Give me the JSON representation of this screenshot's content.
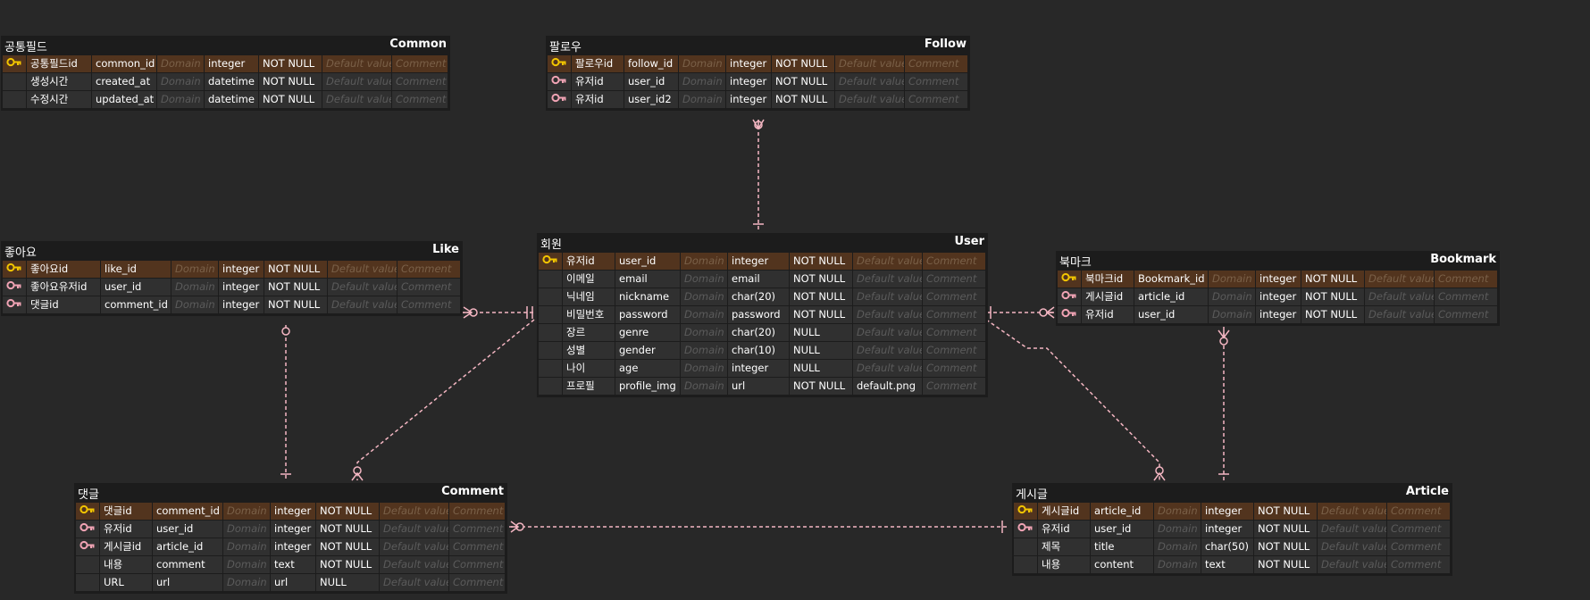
{
  "entities": {
    "common": {
      "logical": "공통필드",
      "physical": "Common",
      "rows": [
        {
          "key": "pk",
          "logical": "공통필드id",
          "physical": "common_id",
          "domain": "Domain",
          "type": "integer",
          "nullable": "NOT NULL",
          "default": "Default value",
          "comment": "Comment"
        },
        {
          "key": "",
          "logical": "생성시간",
          "physical": "created_at",
          "domain": "Domain",
          "type": "datetime",
          "nullable": "NOT NULL",
          "default": "Default value",
          "comment": "Comment"
        },
        {
          "key": "",
          "logical": "수정시간",
          "physical": "updated_at",
          "domain": "Domain",
          "type": "datetime",
          "nullable": "NOT NULL",
          "default": "Default value",
          "comment": "Comment"
        }
      ]
    },
    "follow": {
      "logical": "팔로우",
      "physical": "Follow",
      "rows": [
        {
          "key": "pk",
          "logical": "팔로우id",
          "physical": "follow_id",
          "domain": "Domain",
          "type": "integer",
          "nullable": "NOT NULL",
          "default": "Default value",
          "comment": "Comment"
        },
        {
          "key": "fk",
          "logical": "유저id",
          "physical": "user_id",
          "domain": "Domain",
          "type": "integer",
          "nullable": "NOT NULL",
          "default": "Default value",
          "comment": "Comment"
        },
        {
          "key": "fk",
          "logical": "유저id",
          "physical": "user_id2",
          "domain": "Domain",
          "type": "integer",
          "nullable": "NOT NULL",
          "default": "Default value",
          "comment": "Comment"
        }
      ]
    },
    "like": {
      "logical": "좋아요",
      "physical": "Like",
      "rows": [
        {
          "key": "pk",
          "logical": "좋아요id",
          "physical": "like_id",
          "domain": "Domain",
          "type": "integer",
          "nullable": "NOT NULL",
          "default": "Default value",
          "comment": "Comment"
        },
        {
          "key": "fk",
          "logical": "좋아요유저id",
          "physical": "user_id",
          "domain": "Domain",
          "type": "integer",
          "nullable": "NOT NULL",
          "default": "Default value",
          "comment": "Comment"
        },
        {
          "key": "fk",
          "logical": "댓글id",
          "physical": "comment_id",
          "domain": "Domain",
          "type": "integer",
          "nullable": "NOT NULL",
          "default": "Default value",
          "comment": "Comment"
        }
      ]
    },
    "user": {
      "logical": "회원",
      "physical": "User",
      "rows": [
        {
          "key": "pk",
          "logical": "유저id",
          "physical": "user_id",
          "domain": "Domain",
          "type": "integer",
          "nullable": "NOT NULL",
          "default": "Default value",
          "comment": "Comment"
        },
        {
          "key": "",
          "logical": "이메일",
          "physical": "email",
          "domain": "Domain",
          "type": "email",
          "nullable": "NOT NULL",
          "default": "Default value",
          "comment": "Comment"
        },
        {
          "key": "",
          "logical": "닉네임",
          "physical": "nickname",
          "domain": "Domain",
          "type": "char(20)",
          "nullable": "NOT NULL",
          "default": "Default value",
          "comment": "Comment"
        },
        {
          "key": "",
          "logical": "비밀번호",
          "physical": "password",
          "domain": "Domain",
          "type": "password",
          "nullable": "NOT NULL",
          "default": "Default value",
          "comment": "Comment"
        },
        {
          "key": "",
          "logical": "장르",
          "physical": "genre",
          "domain": "Domain",
          "type": "char(20)",
          "nullable": "NULL",
          "default": "Default value",
          "comment": "Comment"
        },
        {
          "key": "",
          "logical": "성별",
          "physical": "gender",
          "domain": "Domain",
          "type": "char(10)",
          "nullable": "NULL",
          "default": "Default value",
          "comment": "Comment"
        },
        {
          "key": "",
          "logical": "나이",
          "physical": "age",
          "domain": "Domain",
          "type": "integer",
          "nullable": "NULL",
          "default": "Default value",
          "comment": "Comment"
        },
        {
          "key": "",
          "logical": "프로필",
          "physical": "profile_img",
          "domain": "Domain",
          "type": "url",
          "nullable": "NOT NULL",
          "default": "default.png",
          "comment": "Comment"
        }
      ]
    },
    "bookmark": {
      "logical": "북마크",
      "physical": "Bookmark",
      "rows": [
        {
          "key": "pk",
          "logical": "북마크id",
          "physical": "Bookmark_id",
          "domain": "Domain",
          "type": "integer",
          "nullable": "NOT NULL",
          "default": "Default value",
          "comment": "Comment"
        },
        {
          "key": "fk",
          "logical": "게시글id",
          "physical": "article_id",
          "domain": "Domain",
          "type": "integer",
          "nullable": "NOT NULL",
          "default": "Default value",
          "comment": "Comment"
        },
        {
          "key": "fk",
          "logical": "유저id",
          "physical": "user_id",
          "domain": "Domain",
          "type": "integer",
          "nullable": "NOT NULL",
          "default": "Default value",
          "comment": "Comment"
        }
      ]
    },
    "comment": {
      "logical": "댓글",
      "physical": "Comment",
      "rows": [
        {
          "key": "pk",
          "logical": "댓글id",
          "physical": "comment_id",
          "domain": "Domain",
          "type": "integer",
          "nullable": "NOT NULL",
          "default": "Default value",
          "comment": "Comment"
        },
        {
          "key": "fk",
          "logical": "유저id",
          "physical": "user_id",
          "domain": "Domain",
          "type": "integer",
          "nullable": "NOT NULL",
          "default": "Default value",
          "comment": "Comment"
        },
        {
          "key": "fk",
          "logical": "게시글id",
          "physical": "article_id",
          "domain": "Domain",
          "type": "integer",
          "nullable": "NOT NULL",
          "default": "Default value",
          "comment": "Comment"
        },
        {
          "key": "",
          "logical": "내용",
          "physical": "comment",
          "domain": "Domain",
          "type": "text",
          "nullable": "NOT NULL",
          "default": "Default value",
          "comment": "Comment"
        },
        {
          "key": "",
          "logical": "URL",
          "physical": "url",
          "domain": "Domain",
          "type": "url",
          "nullable": "NULL",
          "default": "Default value",
          "comment": "Comment"
        }
      ]
    },
    "article": {
      "logical": "게시글",
      "physical": "Article",
      "rows": [
        {
          "key": "pk",
          "logical": "게시글id",
          "physical": "article_id",
          "domain": "Domain",
          "type": "integer",
          "nullable": "NOT NULL",
          "default": "Default value",
          "comment": "Comment"
        },
        {
          "key": "fk",
          "logical": "유저id",
          "physical": "user_id",
          "domain": "Domain",
          "type": "integer",
          "nullable": "NOT NULL",
          "default": "Default value",
          "comment": "Comment"
        },
        {
          "key": "",
          "logical": "제목",
          "physical": "title",
          "domain": "Domain",
          "type": "char(50)",
          "nullable": "NOT NULL",
          "default": "Default value",
          "comment": "Comment"
        },
        {
          "key": "",
          "logical": "내용",
          "physical": "content",
          "domain": "Domain",
          "type": "text",
          "nullable": "NOT NULL",
          "default": "Default value",
          "comment": "Comment"
        }
      ]
    }
  },
  "colors": {
    "background": "#282828",
    "entity_bg": "#1c1c1c",
    "cell_bg": "#303030",
    "pk_row_bg": "#52341e",
    "pk_key_icon": "#f2c500",
    "fk_key_icon": "#f0a3b4",
    "relation_line": "#f4b6c2"
  },
  "icons": {
    "pk": "primary-key-icon",
    "fk": "foreign-key-icon"
  }
}
